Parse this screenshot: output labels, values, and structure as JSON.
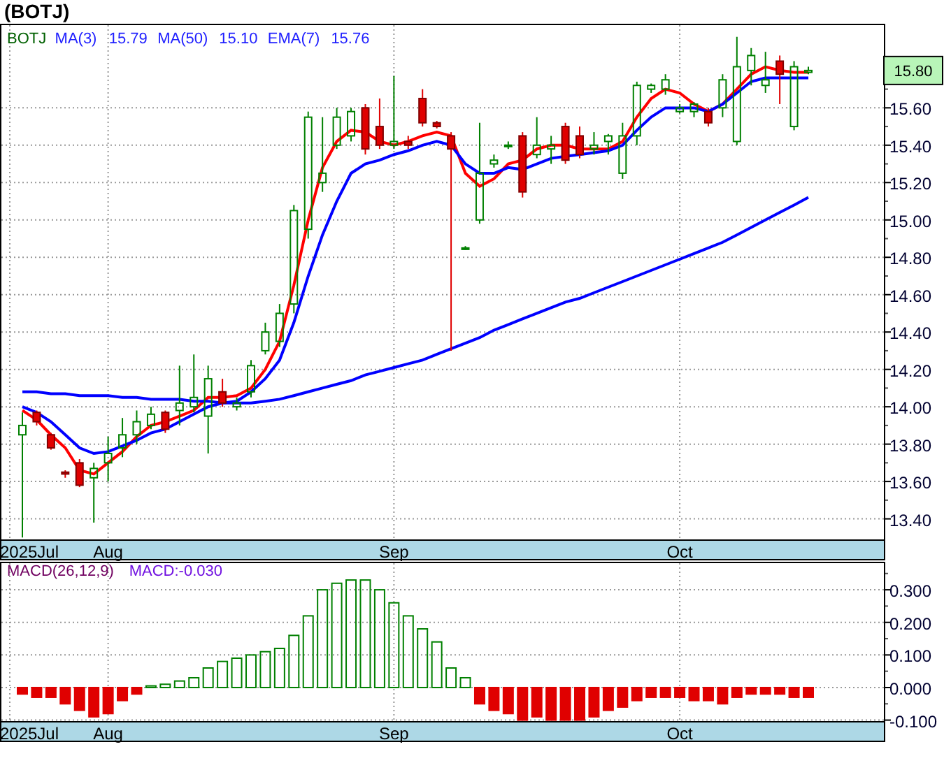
{
  "title": "(BOTJ)",
  "price_chart": {
    "ticker": "BOTJ",
    "legend_values": [
      "15.79",
      "15.10",
      "15.76"
    ],
    "current_price": "15.80",
    "chart_data": {
      "type": "candlestick",
      "grid": true,
      "categories": [
        "2025Jul",
        null,
        null,
        null,
        null,
        null,
        "Aug",
        null,
        null,
        null,
        null,
        null,
        null,
        null,
        null,
        null,
        null,
        null,
        null,
        null,
        null,
        null,
        null,
        null,
        null,
        null,
        "Sep",
        null,
        null,
        null,
        null,
        null,
        null,
        null,
        null,
        null,
        null,
        null,
        null,
        null,
        null,
        null,
        null,
        null,
        null,
        null,
        "Oct",
        null,
        null,
        null,
        null,
        null,
        null,
        null,
        null,
        null
      ],
      "ylim": [
        13.29,
        16.05
      ],
      "yticks": [
        {
          "value": 13.4,
          "label": "13.40"
        },
        {
          "value": 13.6,
          "label": "13.60"
        },
        {
          "value": 13.8,
          "label": "13.80"
        },
        {
          "value": 14.0,
          "label": "14.00"
        },
        {
          "value": 14.2,
          "label": "14.20"
        },
        {
          "value": 14.4,
          "label": "14.40"
        },
        {
          "value": 14.6,
          "label": "14.60"
        },
        {
          "value": 14.8,
          "label": "14.80"
        },
        {
          "value": 15.0,
          "label": "15.00"
        },
        {
          "value": 15.2,
          "label": "15.20"
        },
        {
          "value": 15.4,
          "label": "15.40"
        },
        {
          "value": 15.6,
          "label": "15.60"
        }
      ],
      "series": [
        {
          "name": "MA(3)",
          "type": "line",
          "color": "#ff0000",
          "values": [
            13.98,
            13.93,
            13.85,
            13.78,
            13.66,
            13.64,
            13.7,
            13.76,
            13.84,
            13.9,
            13.92,
            13.95,
            13.98,
            14.05,
            14.05,
            14.06,
            14.1,
            14.2,
            14.35,
            14.65,
            15.0,
            15.28,
            15.42,
            15.48,
            15.47,
            15.42,
            15.4,
            15.42,
            15.45,
            15.47,
            15.45,
            15.25,
            15.18,
            15.22,
            15.3,
            15.32,
            15.38,
            15.4,
            15.4,
            15.38,
            15.38,
            15.38,
            15.42,
            15.55,
            15.65,
            15.7,
            15.68,
            15.62,
            15.58,
            15.62,
            15.7,
            15.78,
            15.82,
            15.8,
            15.79,
            15.79
          ]
        },
        {
          "name": "MA(50)",
          "type": "line",
          "color": "#0000ff",
          "values": [
            14.08,
            14.08,
            14.07,
            14.07,
            14.06,
            14.06,
            14.06,
            14.05,
            14.05,
            14.04,
            14.04,
            14.04,
            14.03,
            14.03,
            14.02,
            14.02,
            14.02,
            14.03,
            14.04,
            14.06,
            14.08,
            14.1,
            14.12,
            14.14,
            14.17,
            14.19,
            14.21,
            14.23,
            14.25,
            14.28,
            14.31,
            14.34,
            14.37,
            14.41,
            14.44,
            14.47,
            14.5,
            14.53,
            14.56,
            14.58,
            14.61,
            14.64,
            14.67,
            14.7,
            14.73,
            14.76,
            14.79,
            14.82,
            14.85,
            14.88,
            14.92,
            14.96,
            15.0,
            15.04,
            15.08,
            15.12
          ]
        },
        {
          "name": "EMA(7)",
          "type": "line",
          "color": "#0000ff",
          "values": [
            14.0,
            13.97,
            13.92,
            13.85,
            13.78,
            13.75,
            13.76,
            13.79,
            13.82,
            13.86,
            13.88,
            13.92,
            13.96,
            14.0,
            14.02,
            14.03,
            14.08,
            14.15,
            14.25,
            14.45,
            14.7,
            14.92,
            15.1,
            15.25,
            15.3,
            15.32,
            15.35,
            15.37,
            15.4,
            15.42,
            15.4,
            15.3,
            15.25,
            15.25,
            15.28,
            15.27,
            15.3,
            15.33,
            15.34,
            15.35,
            15.36,
            15.37,
            15.4,
            15.48,
            15.55,
            15.6,
            15.6,
            15.6,
            15.58,
            15.62,
            15.68,
            15.74,
            15.76,
            15.76,
            15.76,
            15.76
          ]
        }
      ],
      "ohlc": [
        [
          13.85,
          13.97,
          13.3,
          13.9
        ],
        [
          13.97,
          13.98,
          13.9,
          13.92
        ],
        [
          13.85,
          13.86,
          13.77,
          13.78
        ],
        [
          13.65,
          13.66,
          13.62,
          13.64
        ],
        [
          13.7,
          13.72,
          13.57,
          13.58
        ],
        [
          13.62,
          13.7,
          13.38,
          13.67
        ],
        [
          13.7,
          13.84,
          13.6,
          13.75
        ],
        [
          13.78,
          13.94,
          13.73,
          13.85
        ],
        [
          13.85,
          13.98,
          13.8,
          13.92
        ],
        [
          13.9,
          14.0,
          13.88,
          13.96
        ],
        [
          13.97,
          13.98,
          13.86,
          13.88
        ],
        [
          13.98,
          14.22,
          13.9,
          14.02
        ],
        [
          14.0,
          14.28,
          13.97,
          14.05
        ],
        [
          13.95,
          14.22,
          13.75,
          14.15
        ],
        [
          14.08,
          14.15,
          14.0,
          14.02
        ],
        [
          14.0,
          14.05,
          13.98,
          14.02
        ],
        [
          14.08,
          14.25,
          14.05,
          14.22
        ],
        [
          14.3,
          14.45,
          14.28,
          14.4
        ],
        [
          14.35,
          14.55,
          14.32,
          14.5
        ],
        [
          14.55,
          15.08,
          14.5,
          15.05
        ],
        [
          14.95,
          15.58,
          14.9,
          15.55
        ],
        [
          15.2,
          15.55,
          15.15,
          15.25
        ],
        [
          15.4,
          15.6,
          15.38,
          15.55
        ],
        [
          15.45,
          15.6,
          15.42,
          15.58
        ],
        [
          15.6,
          15.62,
          15.35,
          15.38
        ],
        [
          15.5,
          15.65,
          15.38,
          15.4
        ],
        [
          15.4,
          15.77,
          15.38,
          15.42
        ],
        [
          15.42,
          15.45,
          15.38,
          15.4
        ],
        [
          15.65,
          15.7,
          15.5,
          15.52
        ],
        [
          15.52,
          15.53,
          15.49,
          15.5
        ],
        [
          15.45,
          15.47,
          14.3,
          15.38
        ],
        [
          14.85,
          14.86,
          14.84,
          14.85
        ],
        [
          15.0,
          15.52,
          14.98,
          15.25
        ],
        [
          15.3,
          15.35,
          15.28,
          15.32
        ],
        [
          15.4,
          15.42,
          15.38,
          15.4
        ],
        [
          15.45,
          15.47,
          15.12,
          15.15
        ],
        [
          15.35,
          15.55,
          15.33,
          15.4
        ],
        [
          15.38,
          15.45,
          15.3,
          15.4
        ],
        [
          15.5,
          15.52,
          15.3,
          15.32
        ],
        [
          15.45,
          15.5,
          15.33,
          15.35
        ],
        [
          15.38,
          15.47,
          15.35,
          15.4
        ],
        [
          15.42,
          15.46,
          15.35,
          15.45
        ],
        [
          15.25,
          15.52,
          15.22,
          15.45
        ],
        [
          15.45,
          15.74,
          15.4,
          15.72
        ],
        [
          15.7,
          15.73,
          15.68,
          15.72
        ],
        [
          15.7,
          15.78,
          15.67,
          15.75
        ],
        [
          15.58,
          15.62,
          15.57,
          15.6
        ],
        [
          15.58,
          15.63,
          15.55,
          15.62
        ],
        [
          15.58,
          15.6,
          15.5,
          15.52
        ],
        [
          15.6,
          15.78,
          15.55,
          15.75
        ],
        [
          15.42,
          15.98,
          15.4,
          15.82
        ],
        [
          15.8,
          15.92,
          15.72,
          15.88
        ],
        [
          15.72,
          15.9,
          15.68,
          15.75
        ],
        [
          15.85,
          15.88,
          15.62,
          15.78
        ],
        [
          15.5,
          15.85,
          15.48,
          15.82
        ],
        [
          15.79,
          15.82,
          15.78,
          15.8
        ]
      ]
    }
  },
  "macd_chart": {
    "reading": "MACD:-0.030",
    "chart_data": {
      "type": "bar",
      "grid": true,
      "categories": [
        "2025Jul",
        null,
        null,
        null,
        null,
        null,
        "Aug",
        null,
        null,
        null,
        null,
        null,
        null,
        null,
        null,
        null,
        null,
        null,
        null,
        null,
        null,
        null,
        null,
        null,
        null,
        null,
        "Sep",
        null,
        null,
        null,
        null,
        null,
        null,
        null,
        null,
        null,
        null,
        null,
        null,
        null,
        null,
        null,
        null,
        null,
        null,
        null,
        "Oct",
        null,
        null,
        null,
        null,
        null,
        null,
        null,
        null,
        null
      ],
      "ylim": [
        -0.103,
        0.386
      ],
      "yticks": [
        {
          "value": -0.1,
          "label": "-0.100"
        },
        {
          "value": 0,
          "label": "0.000"
        },
        {
          "value": 0.1,
          "label": "0.100"
        },
        {
          "value": 0.2,
          "label": "0.200"
        },
        {
          "value": 0.3,
          "label": "0.300"
        }
      ],
      "series": [
        {
          "name": "MACD(26,12,9)",
          "color": "#008000",
          "values": [
            null,
            null,
            null,
            null,
            null,
            null,
            null,
            null,
            null,
            0.005,
            0.01,
            0.02,
            0.03,
            0.06,
            0.08,
            0.09,
            0.1,
            0.11,
            0.12,
            0.16,
            0.22,
            0.3,
            0.32,
            0.33,
            0.33,
            0.3,
            0.26,
            0.22,
            0.18,
            0.14,
            0.06,
            0.03,
            null,
            null,
            null,
            null,
            null,
            null,
            null,
            null,
            null,
            null,
            null,
            null,
            null,
            null,
            null,
            null,
            null,
            null,
            null,
            null,
            null,
            null,
            null,
            null
          ]
        },
        {
          "color": "#e00000",
          "values": [
            -0.02,
            -0.03,
            -0.03,
            -0.05,
            -0.07,
            -0.09,
            -0.08,
            -0.04,
            -0.02,
            null,
            null,
            null,
            null,
            null,
            null,
            null,
            null,
            null,
            null,
            null,
            null,
            null,
            null,
            null,
            null,
            null,
            null,
            null,
            null,
            null,
            null,
            null,
            -0.05,
            -0.07,
            -0.08,
            -0.1,
            -0.09,
            -0.1,
            -0.1,
            -0.1,
            -0.09,
            -0.07,
            -0.06,
            -0.04,
            -0.03,
            -0.03,
            -0.03,
            -0.04,
            -0.04,
            -0.05,
            -0.03,
            -0.02,
            -0.02,
            -0.02,
            -0.03,
            -0.03
          ]
        }
      ]
    }
  }
}
